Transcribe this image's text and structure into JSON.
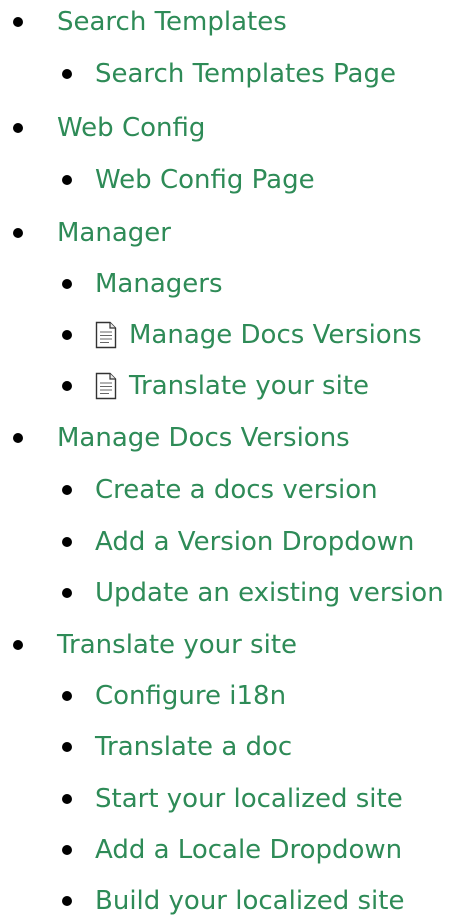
{
  "nav": {
    "items": [
      {
        "label": "Search Templates",
        "level": 0,
        "icon": null
      },
      {
        "label": "Search Templates Page",
        "level": 1,
        "icon": null
      },
      {
        "label": "Web Config",
        "level": 0,
        "icon": null
      },
      {
        "label": "Web Config Page",
        "level": 1,
        "icon": null
      },
      {
        "label": "Manager",
        "level": 0,
        "icon": null
      },
      {
        "label": "Managers",
        "level": 1,
        "icon": null
      },
      {
        "label": "Manage Docs Versions",
        "level": 1,
        "icon": "document-icon"
      },
      {
        "label": "Translate your site",
        "level": 1,
        "icon": "document-icon"
      },
      {
        "label": "Manage Docs Versions",
        "level": 0,
        "icon": null
      },
      {
        "label": "Create a docs version",
        "level": 1,
        "icon": null
      },
      {
        "label": "Add a Version Dropdown",
        "level": 1,
        "icon": null
      },
      {
        "label": "Update an existing version",
        "level": 1,
        "icon": null
      },
      {
        "label": "Translate your site",
        "level": 0,
        "icon": null
      },
      {
        "label": "Configure i18n",
        "level": 1,
        "icon": null
      },
      {
        "label": "Translate a doc",
        "level": 1,
        "icon": null
      },
      {
        "label": "Start your localized site",
        "level": 1,
        "icon": null
      },
      {
        "label": "Add a Locale Dropdown",
        "level": 1,
        "icon": null
      },
      {
        "label": "Build your localized site",
        "level": 1,
        "icon": null
      }
    ]
  },
  "colors": {
    "link": "#2e8b57",
    "bullet": "#000000",
    "background": "#ffffff"
  }
}
